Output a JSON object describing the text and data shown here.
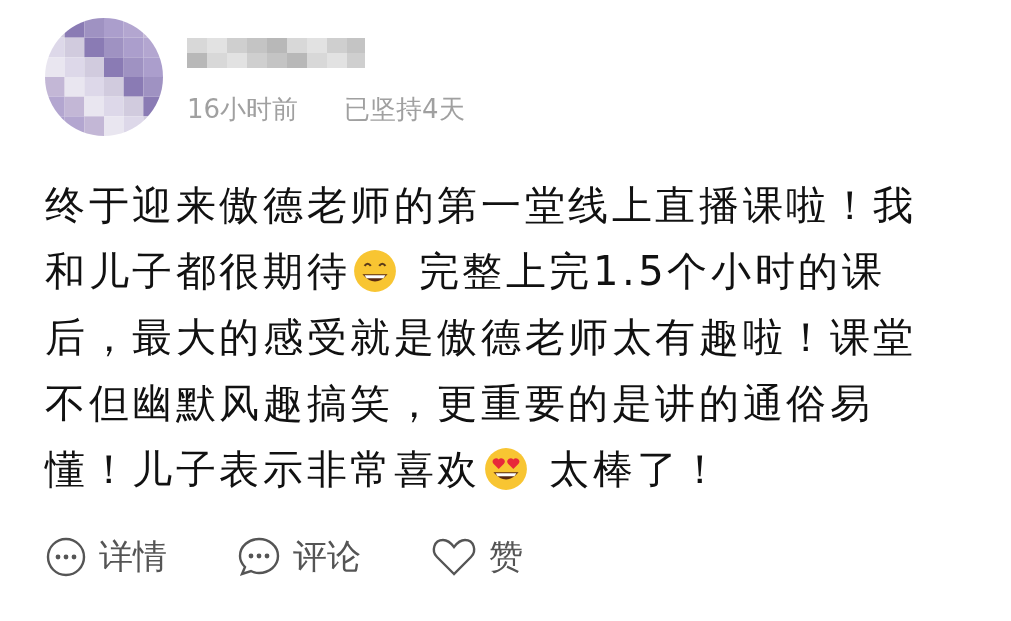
{
  "post": {
    "time": "16小时前",
    "streak": "已坚持4天",
    "body": [
      [
        {
          "kind": "text",
          "text": "终于迎来傲德老师的第一堂线上直播课啦！我"
        }
      ],
      [
        {
          "kind": "text",
          "text": "和儿子都很期待"
        },
        {
          "kind": "grin"
        },
        {
          "kind": "text",
          "text": " 完整上完1.5个小时的课"
        }
      ],
      [
        {
          "kind": "text",
          "text": "后，最大的感受就是傲德老师太有趣啦！课堂"
        }
      ],
      [
        {
          "kind": "text",
          "text": "不但幽默风趣搞笑，更重要的是讲的通俗易"
        }
      ],
      [
        {
          "kind": "text",
          "text": "懂！儿子表示非常喜欢"
        },
        {
          "kind": "heart-eyes"
        },
        {
          "kind": "text",
          "text": " 太棒了！"
        }
      ]
    ],
    "actions": [
      {
        "kind": "details",
        "label": "详情"
      },
      {
        "kind": "comment",
        "label": "评论"
      },
      {
        "kind": "like",
        "label": "赞"
      }
    ]
  }
}
